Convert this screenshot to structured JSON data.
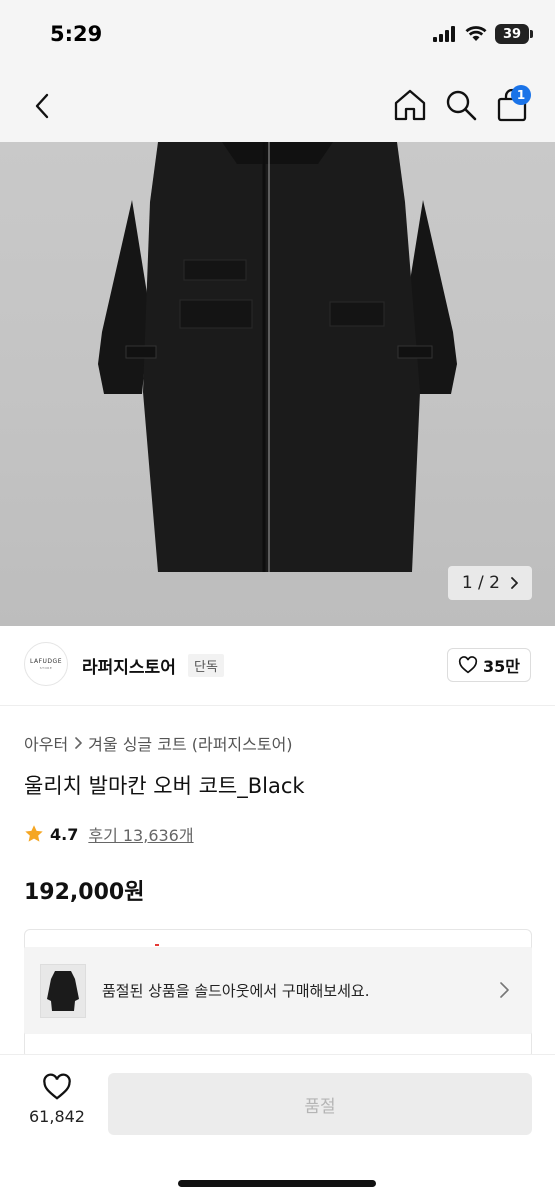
{
  "status": {
    "time": "5:29",
    "battery": "39"
  },
  "nav": {
    "cart_count": "1"
  },
  "gallery": {
    "counter": "1 / 2"
  },
  "store": {
    "logo_text": "LAFUDGE",
    "logo_subtext": "STORE",
    "name": "라퍼지스토어",
    "tag": "단독",
    "likes": "35만"
  },
  "product": {
    "breadcrumb": [
      "아우터",
      "겨울 싱글 코트 (라퍼지스토어)"
    ],
    "title": "울리치 발마칸 오버 코트_Black",
    "rating": "4.7",
    "reviews": "후기 13,636개",
    "price": "192,000원"
  },
  "soldout_banner": {
    "text": "품절된 상품을 솔드아웃에서 구매해보세요."
  },
  "bottom": {
    "wish_count": "61,842",
    "buy_label": "품절"
  },
  "colors": {
    "badge": "#1a73e8",
    "star": "#f5a623",
    "buy_disabled_bg": "#ececec",
    "buy_disabled_text": "#b5b5b5"
  }
}
